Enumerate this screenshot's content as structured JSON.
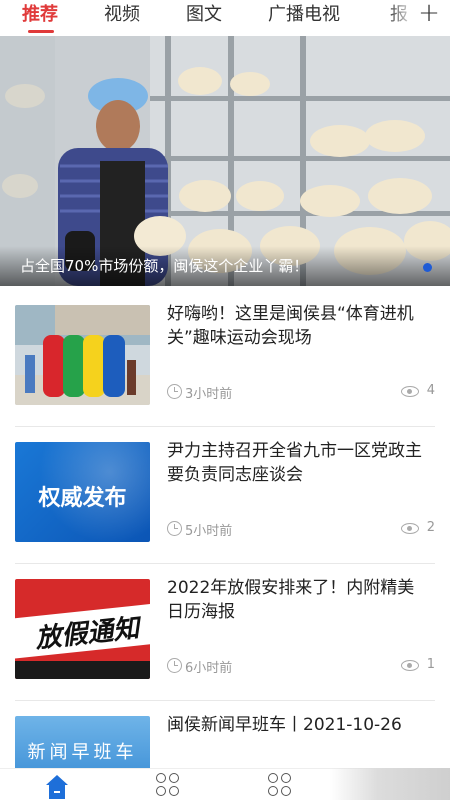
{
  "tabs": [
    {
      "label": "推荐",
      "active": true
    },
    {
      "label": "视频",
      "active": false
    },
    {
      "label": "图文",
      "active": false
    },
    {
      "label": "广播电视",
      "active": false
    },
    {
      "label": "报",
      "active": false
    }
  ],
  "add_button": "+",
  "accent_color": "#e03a3a",
  "hero": {
    "caption": "占全国70%市场份额，闽侯这个企业丫霸！",
    "indicator_color": "#1e5bd6"
  },
  "news": [
    {
      "title": "好嗨哟！这里是闽侯县“体育进机关”趣味运动会现场",
      "time": "3小时前",
      "views": "4",
      "thumb": "sports-event-photo"
    },
    {
      "title": "尹力主持召开全省九市一区党政主要负责同志座谈会",
      "time": "5小时前",
      "views": "2",
      "thumb": "authority-release-banner",
      "thumb_text": "权威发布"
    },
    {
      "title": "2022年放假安排来了！内附精美日历海报",
      "time": "6小时前",
      "views": "1",
      "thumb": "holiday-notice-banner",
      "thumb_text": "放假通知"
    },
    {
      "title": "闽侯新闻早班车丨2021-10-26",
      "time": "",
      "views": "",
      "thumb": "morning-news-banner",
      "thumb_text": "新闻早班车"
    }
  ],
  "bottom_nav": [
    {
      "icon": "home-icon",
      "active": true
    },
    {
      "icon": "grid-icon",
      "active": false
    },
    {
      "icon": "grid-icon",
      "active": false
    }
  ]
}
